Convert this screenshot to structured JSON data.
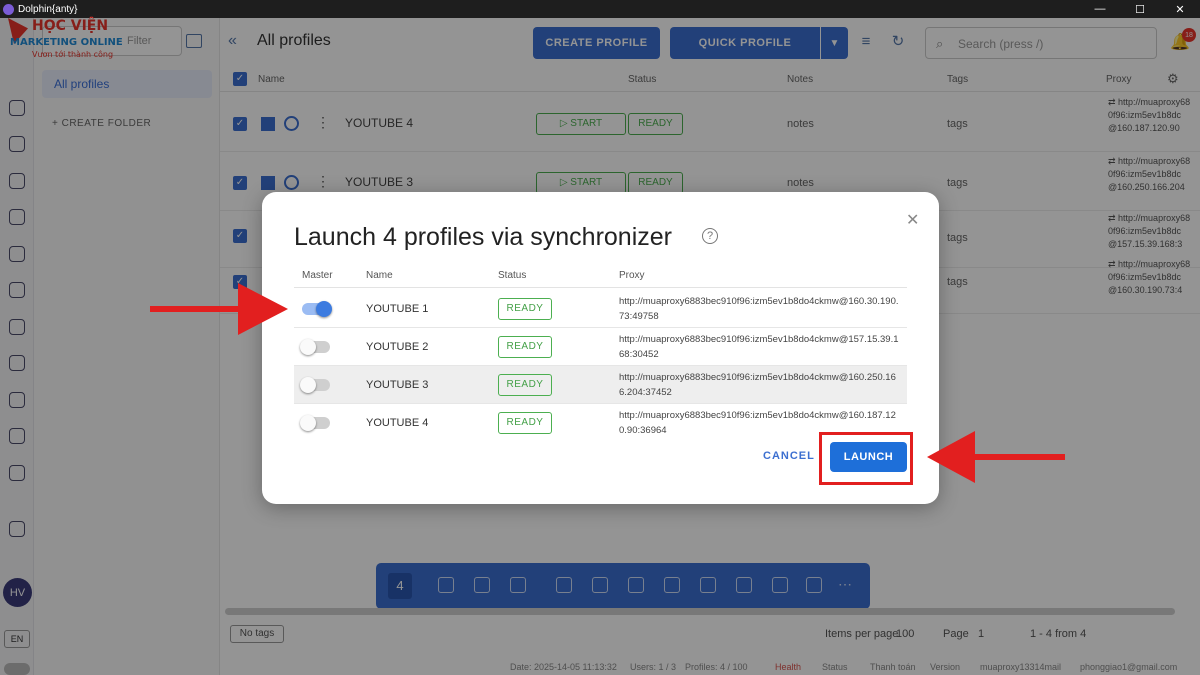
{
  "window": {
    "title": "Dolphin{anty}",
    "controls": [
      "—",
      "☐",
      "✕"
    ]
  },
  "logo": {
    "line1": "HỌC VIỆN",
    "line2": "MARKETING ONLINE",
    "line3": "Vươn tới thành công"
  },
  "sidebar": {
    "search_placeholder": "Filter",
    "all_profiles": "All profiles",
    "create_folder": "+ CREATE FOLDER",
    "avatar": "HV",
    "lang": "EN"
  },
  "header": {
    "back": "«",
    "title": "All profiles",
    "create_profile": "CREATE PROFILE",
    "quick_profile": "QUICK PROFILE",
    "quick_drop": "▼",
    "search_placeholder": "Search (press /)",
    "notif_count": "18"
  },
  "table": {
    "columns": {
      "name": "Name",
      "status": "Status",
      "notes": "Notes",
      "tags": "Tags",
      "proxy": "Proxy"
    },
    "rows": [
      {
        "name": "YOUTUBE 4",
        "start": "▷ START",
        "status": "READY",
        "notes": "notes",
        "tags": "tags",
        "proxy1": "⇄ http://muaproxy68",
        "proxy2": "0f96:izm5ev1b8dc",
        "proxy3": "@160.187.120.90"
      },
      {
        "name": "YOUTUBE 3",
        "start": "▷ START",
        "status": "READY",
        "notes": "notes",
        "tags": "tags",
        "proxy1": "⇄ http://muaproxy68",
        "proxy2": "0f96:izm5ev1b8dc",
        "proxy3": "@160.250.166.204"
      },
      {
        "name": "",
        "start": "",
        "status": "",
        "notes": "",
        "tags": "tags",
        "proxy1": "⇄ http://muaproxy68",
        "proxy2": "0f96:izm5ev1b8dc",
        "proxy3": "@157.15.39.168:3"
      },
      {
        "name": "",
        "start": "",
        "status": "",
        "notes": "",
        "tags": "tags",
        "proxy1": "⇄ http://muaproxy68",
        "proxy2": "0f96:izm5ev1b8dc",
        "proxy3": "@160.30.190.73:4"
      }
    ]
  },
  "floating_bar": {
    "count": "4"
  },
  "footer": {
    "no_tags": "No tags",
    "items_per_page_label": "Items per page",
    "items_per_page": "100",
    "page_label": "Page",
    "page": "1",
    "range": "1 - 4 from 4"
  },
  "statusbar": {
    "date": "Date: 2025-14-05 11:13:32",
    "users": "Users: 1 / 3",
    "profiles": "Profiles: 4 / 100",
    "health": "Health",
    "status": "Status",
    "tutorial": "Thanh toán",
    "version": "Version",
    "build": "muaproxy13314mail",
    "email": "phonggiao1@gmail.com"
  },
  "modal": {
    "title": "Launch 4 profiles via synchronizer",
    "help": "?",
    "close": "✕",
    "columns": {
      "master": "Master",
      "name": "Name",
      "status": "Status",
      "proxy": "Proxy"
    },
    "rows": [
      {
        "master": true,
        "name": "YOUTUBE 1",
        "status": "READY",
        "proxy": "http://muaproxy6883bec910f96:izm5ev1b8do4ckmw@160.30.190.73:49758"
      },
      {
        "master": false,
        "name": "YOUTUBE 2",
        "status": "READY",
        "proxy": "http://muaproxy6883bec910f96:izm5ev1b8do4ckmw@157.15.39.168:30452"
      },
      {
        "master": false,
        "name": "YOUTUBE 3",
        "status": "READY",
        "proxy": "http://muaproxy6883bec910f96:izm5ev1b8do4ckmw@160.250.166.204:37452"
      },
      {
        "master": false,
        "name": "YOUTUBE 4",
        "status": "READY",
        "proxy": "http://muaproxy6883bec910f96:izm5ev1b8do4ckmw@160.187.120.90:36964"
      }
    ],
    "cancel": "CANCEL",
    "launch": "LAUNCH"
  },
  "colors": {
    "accent": "#3c6fd0",
    "launch": "#1e6fd9",
    "ready": "#43a047",
    "annotation": "#e21f1f"
  }
}
